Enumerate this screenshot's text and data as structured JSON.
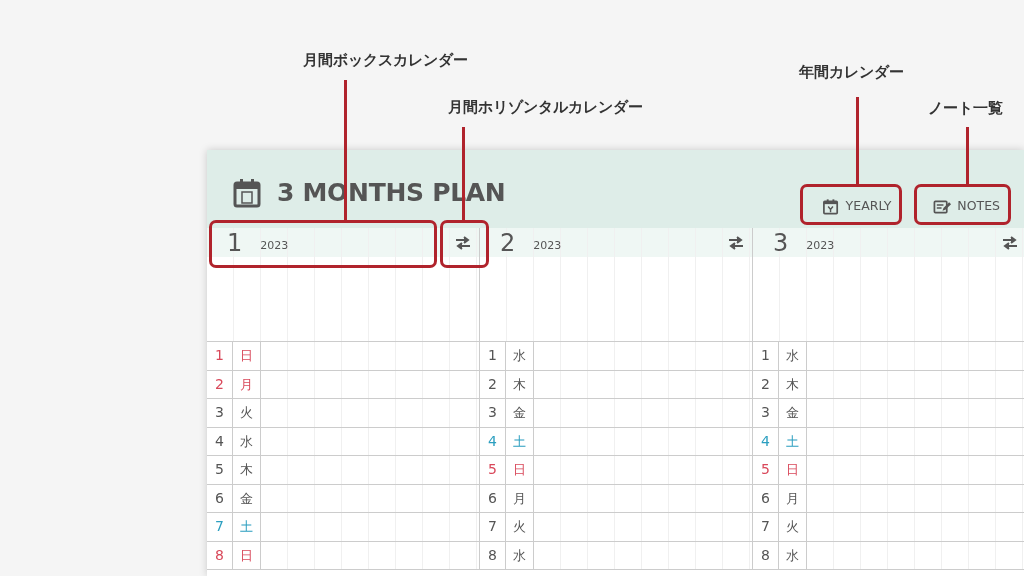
{
  "annotations": [
    {
      "label": "月間ボックスカレンダー"
    },
    {
      "label": "月間ホリゾンタルカレンダー"
    },
    {
      "label": "年間カレンダー"
    },
    {
      "label": "ノート一覧"
    }
  ],
  "planner": {
    "title": "3 MONTHS PLAN",
    "buttons": [
      {
        "kind": "yearly",
        "label": "YEARLY"
      },
      {
        "kind": "notes",
        "label": "NOTES"
      }
    ],
    "months": [
      {
        "month": "1",
        "year": "2023",
        "days": [
          {
            "num": "1",
            "weekday": "日",
            "kind": "holiday"
          },
          {
            "num": "2",
            "weekday": "月",
            "kind": "holiday"
          },
          {
            "num": "3",
            "weekday": "火",
            "kind": "weekday"
          },
          {
            "num": "4",
            "weekday": "水",
            "kind": "weekday"
          },
          {
            "num": "5",
            "weekday": "木",
            "kind": "weekday"
          },
          {
            "num": "6",
            "weekday": "金",
            "kind": "weekday"
          },
          {
            "num": "7",
            "weekday": "土",
            "kind": "saturday"
          },
          {
            "num": "8",
            "weekday": "日",
            "kind": "holiday"
          }
        ]
      },
      {
        "month": "2",
        "year": "2023",
        "days": [
          {
            "num": "1",
            "weekday": "水",
            "kind": "weekday"
          },
          {
            "num": "2",
            "weekday": "木",
            "kind": "weekday"
          },
          {
            "num": "3",
            "weekday": "金",
            "kind": "weekday"
          },
          {
            "num": "4",
            "weekday": "土",
            "kind": "saturday"
          },
          {
            "num": "5",
            "weekday": "日",
            "kind": "holiday"
          },
          {
            "num": "6",
            "weekday": "月",
            "kind": "weekday"
          },
          {
            "num": "7",
            "weekday": "火",
            "kind": "weekday"
          },
          {
            "num": "8",
            "weekday": "水",
            "kind": "weekday"
          }
        ]
      },
      {
        "month": "3",
        "year": "2023",
        "days": [
          {
            "num": "1",
            "weekday": "水",
            "kind": "weekday"
          },
          {
            "num": "2",
            "weekday": "木",
            "kind": "weekday"
          },
          {
            "num": "3",
            "weekday": "金",
            "kind": "weekday"
          },
          {
            "num": "4",
            "weekday": "土",
            "kind": "saturday"
          },
          {
            "num": "5",
            "weekday": "日",
            "kind": "holiday"
          },
          {
            "num": "6",
            "weekday": "月",
            "kind": "weekday"
          },
          {
            "num": "7",
            "weekday": "火",
            "kind": "weekday"
          },
          {
            "num": "8",
            "weekday": "水",
            "kind": "weekday"
          }
        ]
      }
    ]
  }
}
